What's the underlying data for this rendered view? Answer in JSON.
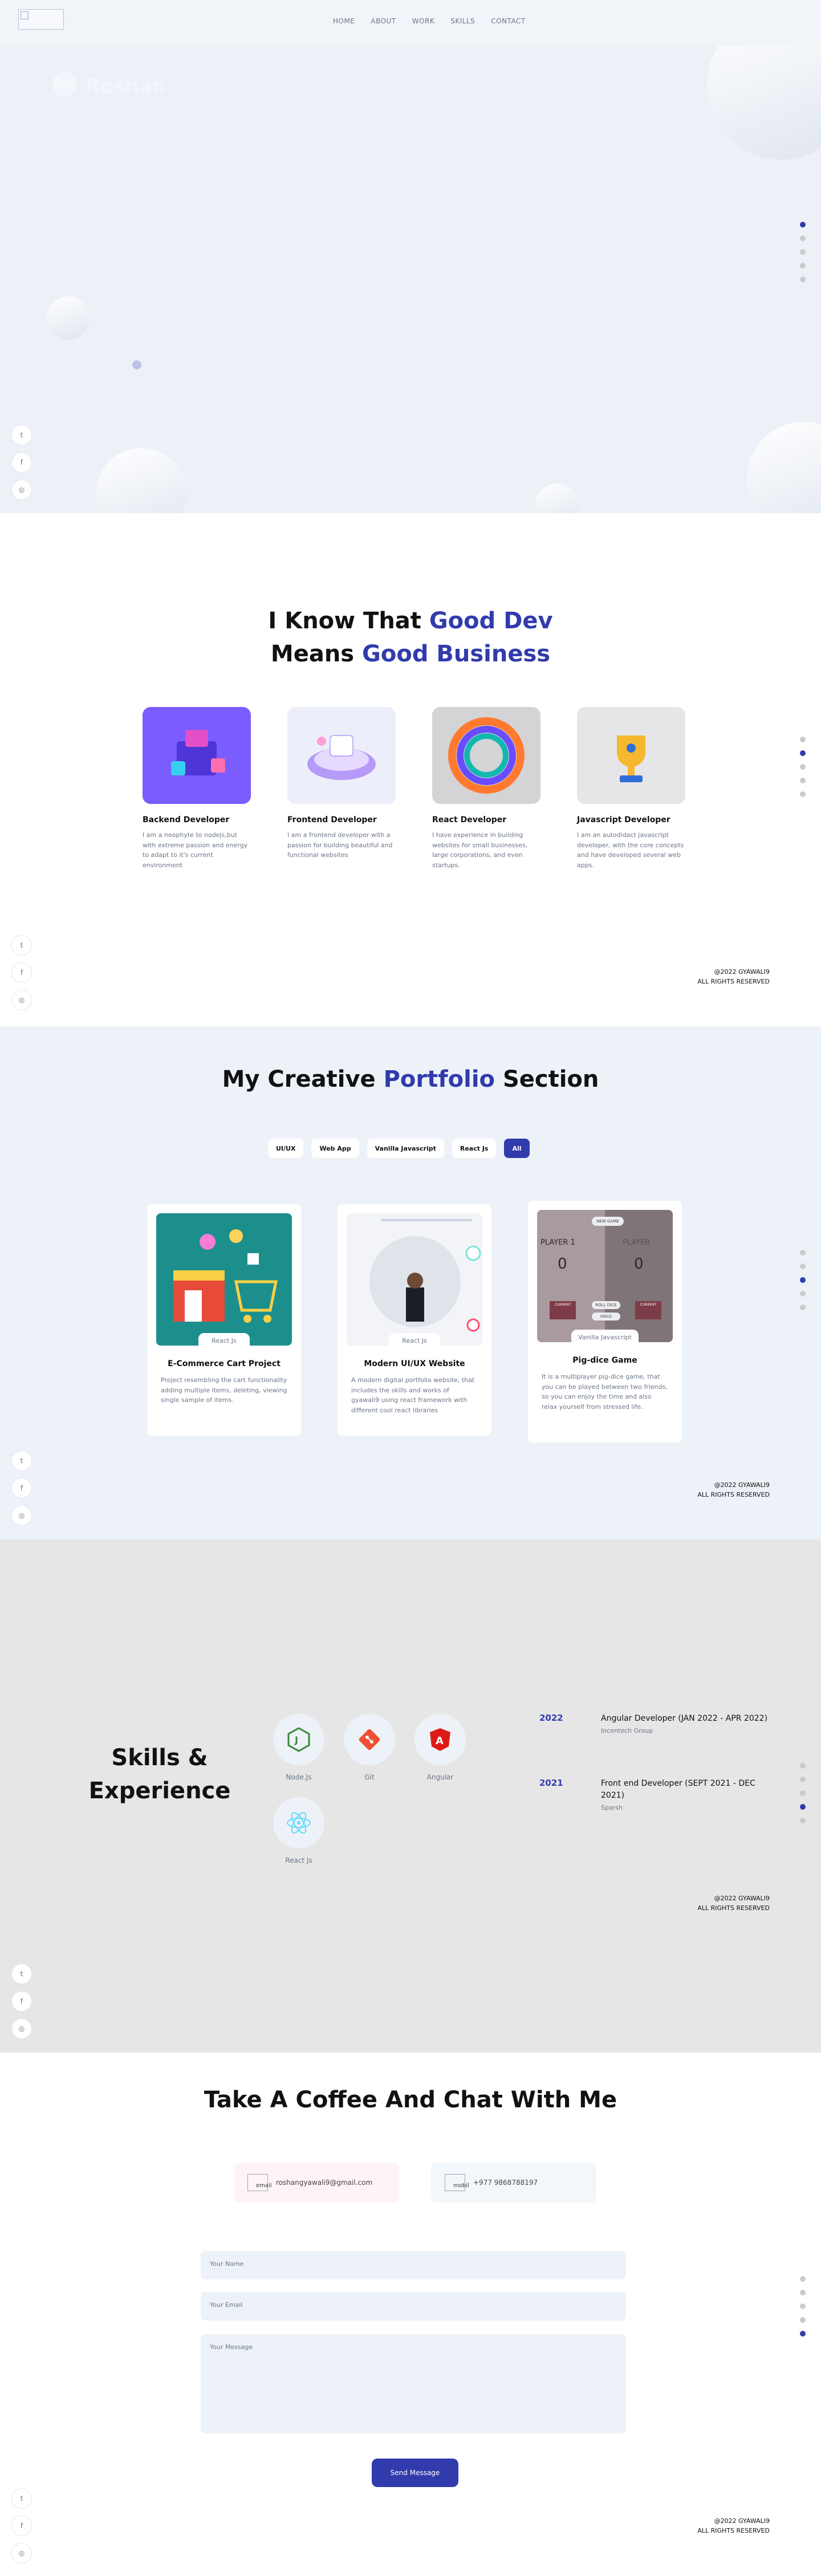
{
  "nav": {
    "logo_alt": "logo",
    "links": [
      "HOME",
      "ABOUT",
      "WORK",
      "SKILLS",
      "CONTACT"
    ]
  },
  "hero": {
    "name": "Roshan"
  },
  "about": {
    "heading_part1": "I Know That ",
    "heading_accent1": "Good Dev",
    "heading_part2": "Means ",
    "heading_accent2": "Good Business",
    "cards": [
      {
        "title": "Backend Developer",
        "desc": "I am a neophyte to nodejs,but with extreme passion and energy to adapt to it's current environment",
        "color": "#7a5cff"
      },
      {
        "title": "Frontend Developer",
        "desc": "I am a frontend developer with a passion for building beautiful and functional websites",
        "color": "#eef0ff"
      },
      {
        "title": "React Developer",
        "desc": "I have experience in building websites for small businesses, large corporations, and even startups.",
        "color": "#d6d6d6"
      },
      {
        "title": "Javascript Developer",
        "desc": "I am an autodidact javascript developer, with the core concepts and have developed several web apps.",
        "color": "#e4e4e4"
      }
    ]
  },
  "work": {
    "heading_part1": "My Creative ",
    "heading_accent": "Portfolio",
    "heading_part2": " Section",
    "filters": [
      "UI/UX",
      "Web App",
      "Vanilla Javascript",
      "React Js",
      "All"
    ],
    "active_filter": "All",
    "cards": [
      {
        "title": "E-Commerce Cart Project",
        "tag": "React Js",
        "desc": "Project resembling the cart functionality adding multiple items, deleting, viewing single sample of items."
      },
      {
        "title": "Modern UI/UX Website",
        "tag": "React Js",
        "desc": "A modern digital portfolio website, that includes the skills and works of gyawali9 using react framework with different cool react libraries"
      },
      {
        "title": "Pig-dice Game",
        "tag": "Vanilla Javascript",
        "desc": "It is a multiplayer pig-dice game, that you can be played between two friends, so you can enjoy the time and also relax yourself from stressed life."
      }
    ],
    "game": {
      "player1": "PLAYER 1",
      "player2": "PLAYER",
      "score1": "0",
      "score2": "0",
      "new_game": "NEW GAME",
      "roll": "ROLL DICE",
      "hold": "HOLD",
      "current": "CURRENT"
    }
  },
  "skills": {
    "heading_line1": "Skills &",
    "heading_line2": "Experience",
    "items": [
      {
        "name": "Node.Js",
        "icon": "nodejs-icon",
        "color": "#3c873a"
      },
      {
        "name": "Git",
        "icon": "git-icon",
        "color": "#f05032"
      },
      {
        "name": "Angular",
        "icon": "angular-icon",
        "color": "#dd1b16"
      },
      {
        "name": "React Js",
        "icon": "react-icon",
        "color": "#61dafb"
      }
    ],
    "experiences": [
      {
        "year": "2022",
        "title": "Angular Developer (JAN 2022 - APR 2022)",
        "company": "Incentech Group"
      },
      {
        "year": "2021",
        "title": "Front end Developer (SEPT 2021 - DEC 2021)",
        "company": "Sparsh"
      }
    ]
  },
  "contact": {
    "heading": "Take A Coffee And Chat With Me",
    "email_alt": "email",
    "email": "roshangyawali9@gmail.com",
    "mobile_alt": "mobil",
    "phone": "+977 9868788197",
    "name_placeholder": "Your Name",
    "email_placeholder": "Your Email",
    "message_placeholder": "Your Message",
    "send": "Send Message"
  },
  "footer": {
    "line1": "@2022 GYAWALI9",
    "line2": "ALL RIGHTS RESERVED"
  },
  "colors": {
    "accent": "#313bac",
    "bg": "#edf2f8"
  }
}
